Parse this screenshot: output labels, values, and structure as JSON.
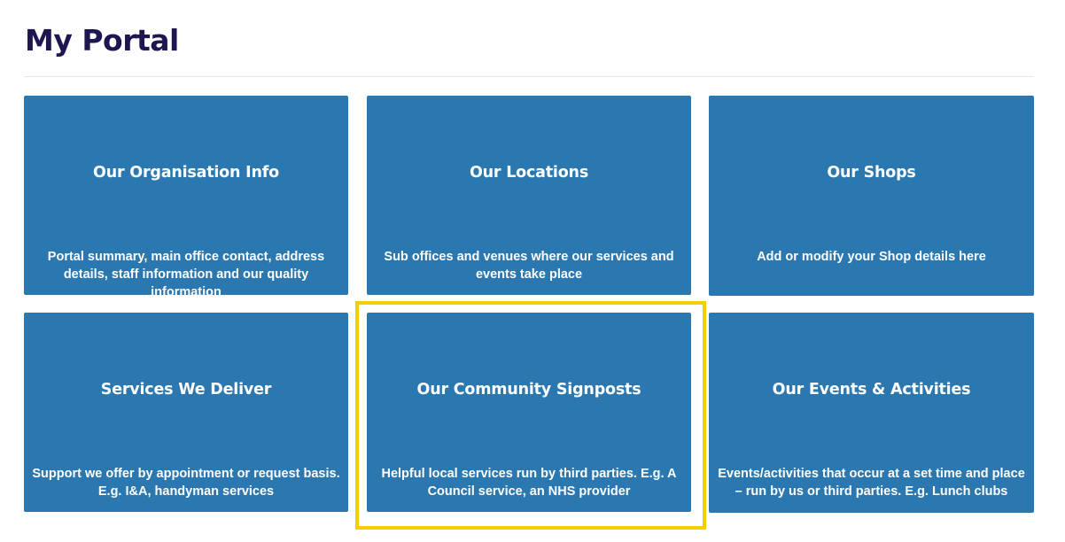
{
  "page": {
    "title": "My Portal"
  },
  "tiles": [
    {
      "title": "Our Organisation Info",
      "description": "Portal summary, main office contact, address details, staff information and our quality information"
    },
    {
      "title": "Our Locations",
      "description": "Sub offices and venues where our services and events take place"
    },
    {
      "title": "Our Shops",
      "description": "Add or modify your Shop details here"
    },
    {
      "title": "Services We Deliver",
      "description": "Support we offer by appointment or request basis. E.g. I&A, handyman services"
    },
    {
      "title": "Our Community Signposts",
      "description": "Helpful local services run by third parties. E.g. A Council service, an NHS provider"
    },
    {
      "title": "Our Events & Activities",
      "description": "Events/activities that occur at a set time and place – run by us or third parties. E.g. Lunch clubs"
    }
  ],
  "colors": {
    "title": "#1e1650",
    "tile_background": "#2b78b1",
    "tile_text": "#ffffff",
    "highlight_border": "#f7cc00",
    "divider": "#e6e6e6"
  }
}
